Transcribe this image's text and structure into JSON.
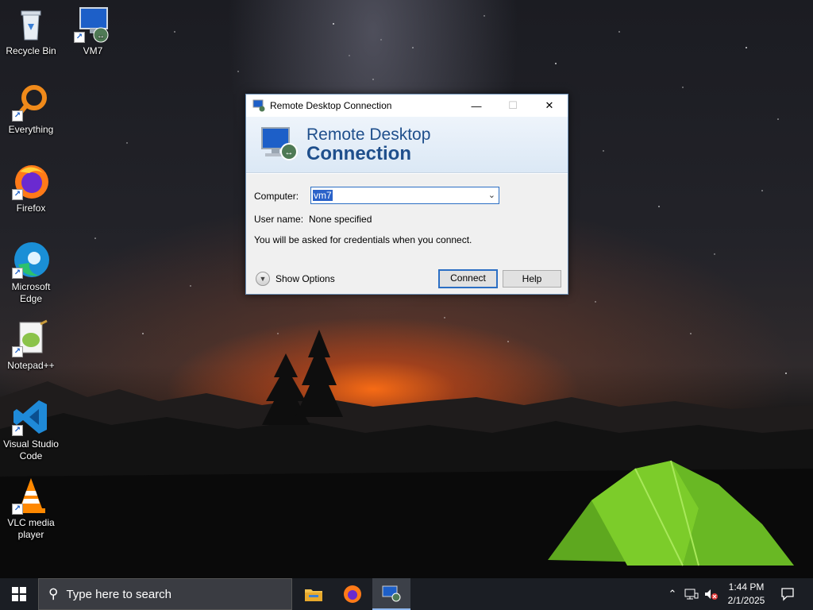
{
  "desktop": {
    "icons": [
      {
        "label": "Recycle Bin"
      },
      {
        "label": "VM7"
      },
      {
        "label": "Everything"
      },
      {
        "label": "Firefox"
      },
      {
        "label": "Microsoft Edge"
      },
      {
        "label": "Notepad++"
      },
      {
        "label": "Visual Studio Code"
      },
      {
        "label": "VLC media player"
      }
    ]
  },
  "dialog": {
    "title": "Remote Desktop Connection",
    "banner_line1": "Remote Desktop",
    "banner_line2": "Connection",
    "computer_label": "Computer:",
    "computer_value": "vm7",
    "username_label": "User name:",
    "username_value": "None specified",
    "info_text": "You will be asked for credentials when you connect.",
    "show_options": "Show Options",
    "connect_button": "Connect",
    "help_button": "Help"
  },
  "taskbar": {
    "search_placeholder": "Type here to search",
    "time": "1:44 PM",
    "date": "2/1/2025"
  }
}
